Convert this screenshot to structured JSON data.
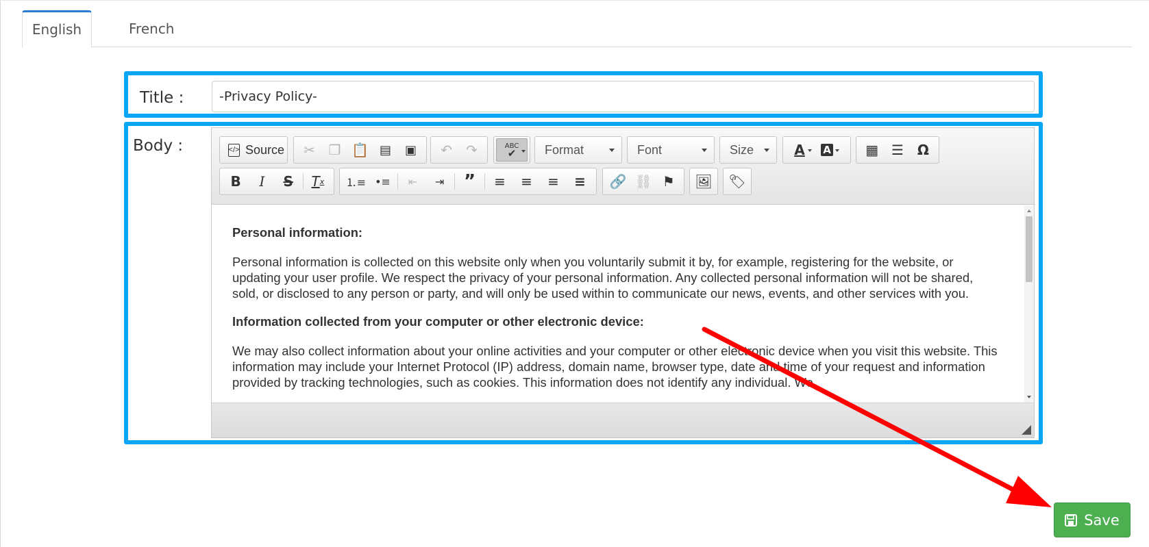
{
  "tabs": [
    {
      "label": "English",
      "active": true
    },
    {
      "label": "French",
      "active": false
    }
  ],
  "form": {
    "title_label": "Title :",
    "title_value": "-Privacy Policy-",
    "body_label": "Body :"
  },
  "toolbar": {
    "source_label": "Source",
    "format_label": "Format",
    "font_label": "Font",
    "size_label": "Size"
  },
  "content": {
    "heading1": "Personal information:",
    "para1": "Personal information is collected on this website only when you voluntarily submit it by, for example, registering for the website, or updating your user profile. We respect the privacy of your personal information. Any collected personal information will not be shared, sold, or disclosed to any person or party, and will only be used within to communicate our news, events, and other services with you.",
    "heading2": "Information collected from your computer or other electronic device:",
    "para2": "We may also collect information about your online activities and your computer or other electronic device when you visit this website. This information may include your Internet Protocol (IP) address, domain name, browser type, date and time of your request and information provided by tracking technologies, such as cookies. This information does not identify any individual. We"
  },
  "actions": {
    "save_label": "Save"
  },
  "colors": {
    "highlight_frame": "#0aa6f5",
    "annotation_arrow": "#ff0000",
    "save_button": "#4caf50",
    "active_tab_border": "#2a7bd6"
  },
  "icons": {
    "save": "floppy-disk-icon",
    "source": "source-code-icon"
  }
}
